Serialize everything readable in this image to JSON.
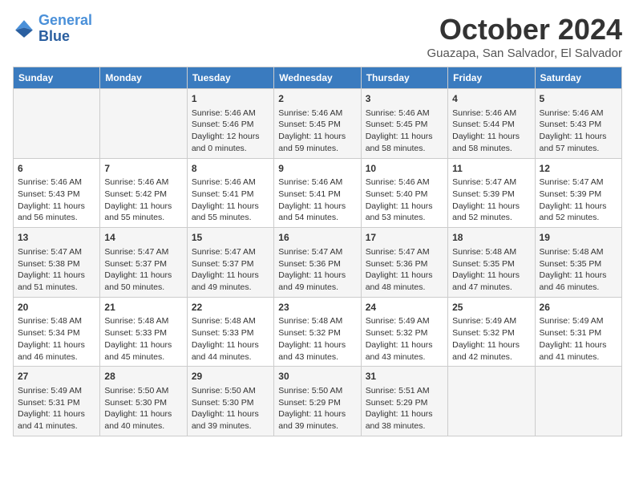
{
  "header": {
    "logo_line1": "General",
    "logo_line2": "Blue",
    "month": "October 2024",
    "location": "Guazapa, San Salvador, El Salvador"
  },
  "days_of_week": [
    "Sunday",
    "Monday",
    "Tuesday",
    "Wednesday",
    "Thursday",
    "Friday",
    "Saturday"
  ],
  "weeks": [
    [
      {
        "day": "",
        "info": ""
      },
      {
        "day": "",
        "info": ""
      },
      {
        "day": "1",
        "info": "Sunrise: 5:46 AM\nSunset: 5:46 PM\nDaylight: 12 hours and 0 minutes."
      },
      {
        "day": "2",
        "info": "Sunrise: 5:46 AM\nSunset: 5:45 PM\nDaylight: 11 hours and 59 minutes."
      },
      {
        "day": "3",
        "info": "Sunrise: 5:46 AM\nSunset: 5:45 PM\nDaylight: 11 hours and 58 minutes."
      },
      {
        "day": "4",
        "info": "Sunrise: 5:46 AM\nSunset: 5:44 PM\nDaylight: 11 hours and 58 minutes."
      },
      {
        "day": "5",
        "info": "Sunrise: 5:46 AM\nSunset: 5:43 PM\nDaylight: 11 hours and 57 minutes."
      }
    ],
    [
      {
        "day": "6",
        "info": "Sunrise: 5:46 AM\nSunset: 5:43 PM\nDaylight: 11 hours and 56 minutes."
      },
      {
        "day": "7",
        "info": "Sunrise: 5:46 AM\nSunset: 5:42 PM\nDaylight: 11 hours and 55 minutes."
      },
      {
        "day": "8",
        "info": "Sunrise: 5:46 AM\nSunset: 5:41 PM\nDaylight: 11 hours and 55 minutes."
      },
      {
        "day": "9",
        "info": "Sunrise: 5:46 AM\nSunset: 5:41 PM\nDaylight: 11 hours and 54 minutes."
      },
      {
        "day": "10",
        "info": "Sunrise: 5:46 AM\nSunset: 5:40 PM\nDaylight: 11 hours and 53 minutes."
      },
      {
        "day": "11",
        "info": "Sunrise: 5:47 AM\nSunset: 5:39 PM\nDaylight: 11 hours and 52 minutes."
      },
      {
        "day": "12",
        "info": "Sunrise: 5:47 AM\nSunset: 5:39 PM\nDaylight: 11 hours and 52 minutes."
      }
    ],
    [
      {
        "day": "13",
        "info": "Sunrise: 5:47 AM\nSunset: 5:38 PM\nDaylight: 11 hours and 51 minutes."
      },
      {
        "day": "14",
        "info": "Sunrise: 5:47 AM\nSunset: 5:37 PM\nDaylight: 11 hours and 50 minutes."
      },
      {
        "day": "15",
        "info": "Sunrise: 5:47 AM\nSunset: 5:37 PM\nDaylight: 11 hours and 49 minutes."
      },
      {
        "day": "16",
        "info": "Sunrise: 5:47 AM\nSunset: 5:36 PM\nDaylight: 11 hours and 49 minutes."
      },
      {
        "day": "17",
        "info": "Sunrise: 5:47 AM\nSunset: 5:36 PM\nDaylight: 11 hours and 48 minutes."
      },
      {
        "day": "18",
        "info": "Sunrise: 5:48 AM\nSunset: 5:35 PM\nDaylight: 11 hours and 47 minutes."
      },
      {
        "day": "19",
        "info": "Sunrise: 5:48 AM\nSunset: 5:35 PM\nDaylight: 11 hours and 46 minutes."
      }
    ],
    [
      {
        "day": "20",
        "info": "Sunrise: 5:48 AM\nSunset: 5:34 PM\nDaylight: 11 hours and 46 minutes."
      },
      {
        "day": "21",
        "info": "Sunrise: 5:48 AM\nSunset: 5:33 PM\nDaylight: 11 hours and 45 minutes."
      },
      {
        "day": "22",
        "info": "Sunrise: 5:48 AM\nSunset: 5:33 PM\nDaylight: 11 hours and 44 minutes."
      },
      {
        "day": "23",
        "info": "Sunrise: 5:48 AM\nSunset: 5:32 PM\nDaylight: 11 hours and 43 minutes."
      },
      {
        "day": "24",
        "info": "Sunrise: 5:49 AM\nSunset: 5:32 PM\nDaylight: 11 hours and 43 minutes."
      },
      {
        "day": "25",
        "info": "Sunrise: 5:49 AM\nSunset: 5:32 PM\nDaylight: 11 hours and 42 minutes."
      },
      {
        "day": "26",
        "info": "Sunrise: 5:49 AM\nSunset: 5:31 PM\nDaylight: 11 hours and 41 minutes."
      }
    ],
    [
      {
        "day": "27",
        "info": "Sunrise: 5:49 AM\nSunset: 5:31 PM\nDaylight: 11 hours and 41 minutes."
      },
      {
        "day": "28",
        "info": "Sunrise: 5:50 AM\nSunset: 5:30 PM\nDaylight: 11 hours and 40 minutes."
      },
      {
        "day": "29",
        "info": "Sunrise: 5:50 AM\nSunset: 5:30 PM\nDaylight: 11 hours and 39 minutes."
      },
      {
        "day": "30",
        "info": "Sunrise: 5:50 AM\nSunset: 5:29 PM\nDaylight: 11 hours and 39 minutes."
      },
      {
        "day": "31",
        "info": "Sunrise: 5:51 AM\nSunset: 5:29 PM\nDaylight: 11 hours and 38 minutes."
      },
      {
        "day": "",
        "info": ""
      },
      {
        "day": "",
        "info": ""
      }
    ]
  ]
}
